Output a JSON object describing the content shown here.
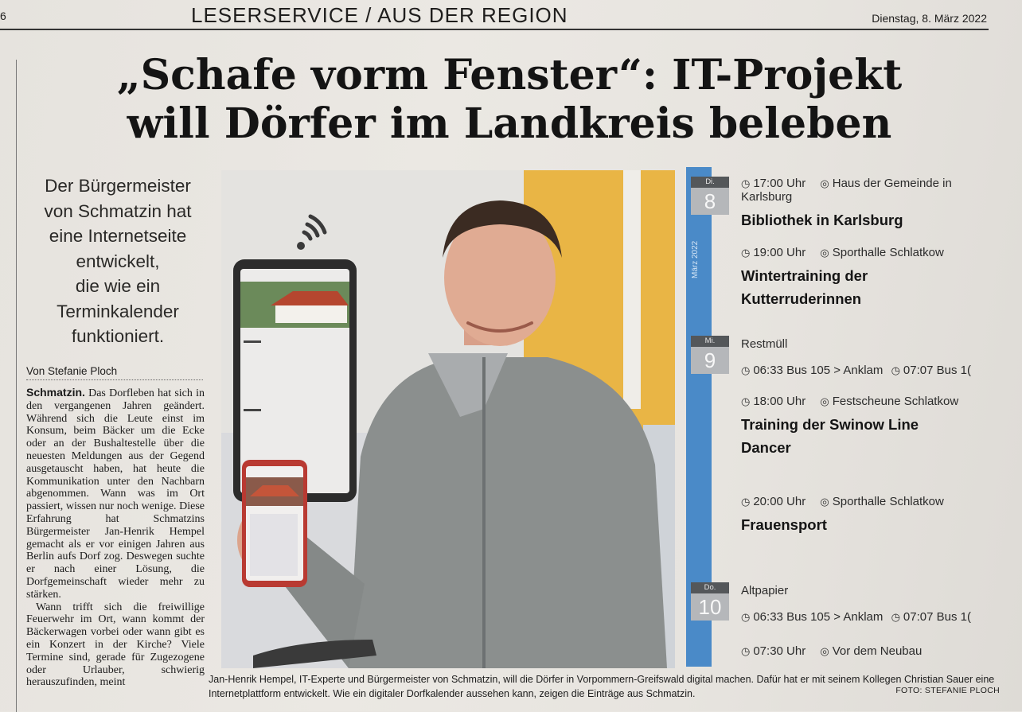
{
  "header": {
    "page_number": "6",
    "section": "LESERSERVICE / AUS DER REGION",
    "date": "Dienstag, 8. März 2022"
  },
  "article": {
    "headline_line1": "„Schafe vorm Fenster“: IT-Projekt",
    "headline_line2": "will Dörfer im Landkreis beleben",
    "teaser_lines": [
      "Der Bürgermeister",
      "von Schmatzin hat",
      "eine Internetseite",
      "entwickelt,",
      "die wie ein",
      "Terminkalender",
      "funktioniert."
    ],
    "byline": "Von Stefanie Ploch",
    "dateline": "Schmatzin.",
    "paragraph1": "Das Dorfleben hat sich in den vergangenen Jahren geändert. Während sich die Leute einst im Konsum, beim Bäcker um die Ecke oder an der Bushaltestelle über die neuesten Meldungen aus der Gegend ausgetauscht haben, hat heute die Kommunikation unter den Nachbarn abgenommen. Wann was im Ort passiert, wissen nur noch wenige. Diese Erfahrung hat Schmatzins Bürgermeister Jan-Henrik Hempel gemacht als er vor einigen Jahren aus Berlin aufs Dorf zog. Deswegen suchte er nach einer Lösung, die Dorfgemeinschaft wieder mehr zu stärken.",
    "paragraph2": "Wann trifft sich die freiwillige Feuerwehr im Ort, wann kommt der Bäckerwagen vorbei oder wann gibt es ein Konzert in der Kirche? Viele Termine sind, gerade für Zugezogene oder Urlauber, schwierig herauszufinden, meint",
    "caption": "Jan-Henrik Hempel, IT-Experte und Bürgermeister von Schmatzin, will die Dörfer in Vorpommern-Greifswald digital machen. Dafür hat er mit seinem Kollegen Christian Sauer eine Internetplattform entwickelt. Wie ein digitaler Dorfkalender aussehen kann, zeigen die Einträge aus Schmatzin.",
    "photo_credit": "FOTO: STEFANIE PLOCH"
  },
  "calendar": {
    "month_label": "März 2022",
    "days": [
      {
        "label": "Di.",
        "number": "8"
      },
      {
        "label": "Mi.",
        "number": "9"
      },
      {
        "label": "Do.",
        "number": "10"
      }
    ],
    "events": [
      {
        "time": "17:00 Uhr",
        "place": "Haus der Gemeinde in Karlsburg",
        "title": "Bibliothek in Karlsburg"
      },
      {
        "time": "19:00 Uhr",
        "place": "Sporthalle Schlatkow",
        "title_line1": "Wintertraining der",
        "title_line2": "Kutterruderinnen"
      },
      {
        "category": "Restmüll",
        "time1": "06:33",
        "route": "Bus 105 > Anklam",
        "time2": "07:07",
        "route2": "Bus 1("
      },
      {
        "time": "18:00 Uhr",
        "place": "Festscheune Schlatkow",
        "title_line1": "Training der Swinow Line",
        "title_line2": "Dancer"
      },
      {
        "time": "20:00 Uhr",
        "place": "Sporthalle Schlatkow",
        "title": "Frauensport"
      },
      {
        "category": "Altpapier",
        "time1": "06:33",
        "route": "Bus 105 > Anklam",
        "time2": "07:07",
        "route2": "Bus 1("
      },
      {
        "time": "07:30 Uhr",
        "place": "Vor dem Neubau"
      }
    ]
  },
  "colors": {
    "calendar_blue": "#4a8ac8",
    "day_label_bg": "#54575a",
    "day_number_bg": "#b5b7ba",
    "accent_yellow": "#e9b545"
  },
  "icons": [
    "wifi-icon",
    "clock-icon",
    "location-pin-icon"
  ]
}
